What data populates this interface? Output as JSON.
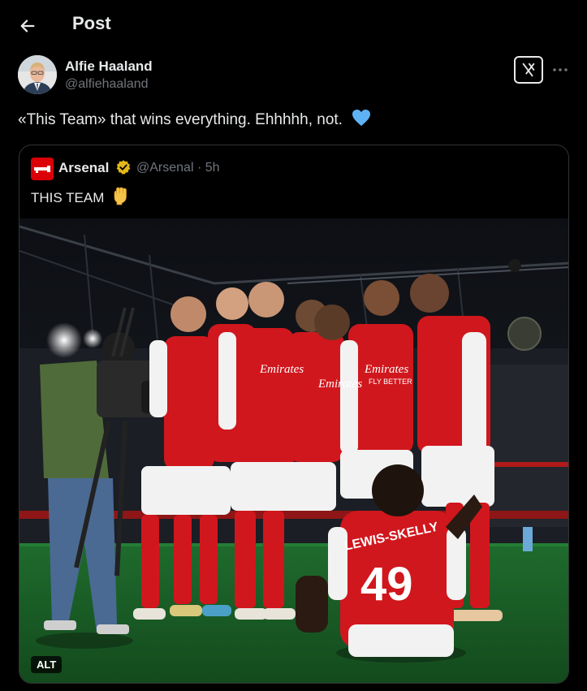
{
  "header": {
    "title": "Post"
  },
  "post": {
    "author_name": "Alfie Haaland",
    "author_handle": "@alfiehaaland",
    "text": "«This Team» that wins everything. Ehhhhh, not."
  },
  "quoted": {
    "author_name": "Arsenal",
    "handle_time": "@Arsenal · 5h",
    "text": "THIS TEAM",
    "image_alt_label": "ALT"
  },
  "photo": {
    "player_name": "LEWIS-SKELLY",
    "player_number": "49",
    "sponsor": "Emirates",
    "sponsor_sub": "FLY BETTER"
  },
  "colors": {
    "background": "#000000",
    "text": "#e7e9ea",
    "muted": "#71767b",
    "heart": "#5eb3f5",
    "arsenal_red": "#db0007",
    "verified_gold": "#e2b719",
    "pitch": "#1f6b2d"
  },
  "icons": [
    "back-arrow-icon",
    "grok-icon",
    "more-icon",
    "blue-heart-icon",
    "arsenal-logo-icon",
    "verified-badge-icon",
    "raised-fist-icon"
  ]
}
